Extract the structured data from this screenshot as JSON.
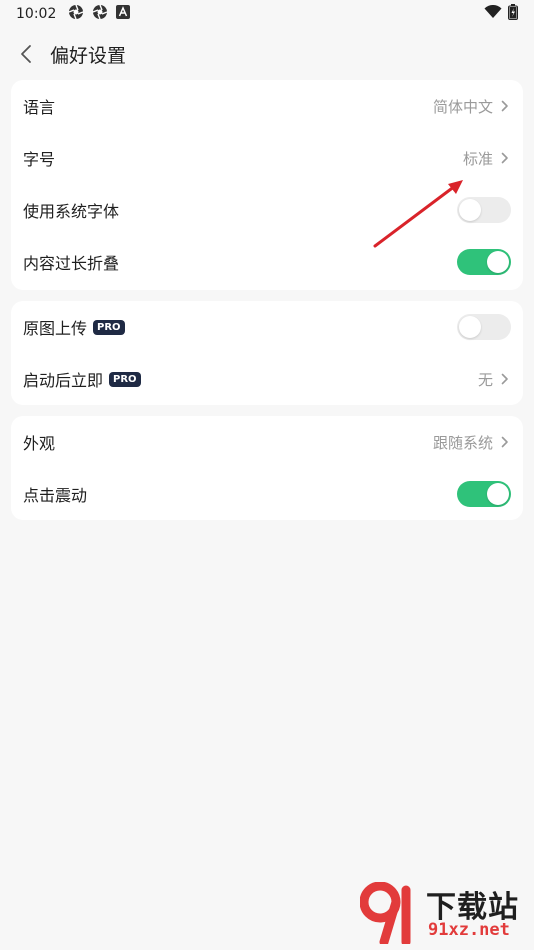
{
  "status_bar": {
    "time": "10:02",
    "icons": [
      "aperture-icon",
      "aperture-icon",
      "font-a-icon"
    ],
    "right_icons": [
      "wifi-icon",
      "battery-icon"
    ]
  },
  "header": {
    "title": "偏好设置",
    "back_icon": "chevron-left-icon"
  },
  "group1": {
    "language": {
      "label": "语言",
      "value": "简体中文"
    },
    "font_size": {
      "label": "字号",
      "value": "标准"
    },
    "system_font": {
      "label": "使用系统字体",
      "enabled": false
    },
    "collapse_long": {
      "label": "内容过长折叠",
      "enabled": true
    }
  },
  "group2": {
    "original_upload": {
      "label": "原图上传",
      "badge": "PRO",
      "enabled": false
    },
    "launch_action": {
      "label": "启动后立即",
      "badge": "PRO",
      "value": "无"
    }
  },
  "group3": {
    "appearance": {
      "label": "外观",
      "value": "跟随系统"
    },
    "tap_vibration": {
      "label": "点击震动",
      "enabled": true
    }
  },
  "watermark": {
    "title": "下载站",
    "url": "91xz.net"
  },
  "colors": {
    "toggle_on": "#2fc27a",
    "toggle_off": "#ececec",
    "badge_bg": "#1f2a44",
    "arrow": "#d9232a"
  }
}
